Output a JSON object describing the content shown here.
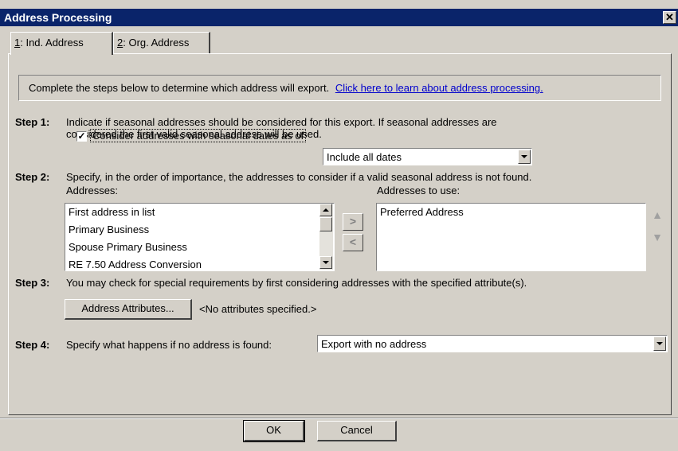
{
  "window": {
    "title": "Address Processing",
    "close_symbol": "✕"
  },
  "tabs": [
    {
      "hotkey": "1",
      "rest": ": Ind. Address"
    },
    {
      "hotkey": "2",
      "rest": ": Org. Address"
    }
  ],
  "intro": {
    "text": "Complete the steps below to determine which address will export.",
    "link": "Click here to learn about address processing."
  },
  "step1": {
    "label": "Step 1:",
    "line1": "Indicate if seasonal addresses should be considered for this export.  If seasonal addresses are",
    "line2": "considered the first valid seasonal address will be used.",
    "checkbox_checked": true,
    "checkbox_mark": "✓",
    "checkbox_label": "Consider addresses with seasonal dates as of",
    "dates_select_value": "Include all dates"
  },
  "step2": {
    "label": "Step 2:",
    "text": "Specify, in the order of importance, the addresses to consider if a valid seasonal address is not found.",
    "addresses_label": "Addresses:",
    "addresses": [
      "First address in list",
      "Primary Business",
      "Spouse Primary Business",
      "RE 7.50 Address Conversion"
    ],
    "addresses_to_use_label": "Addresses to use:",
    "addresses_to_use": [
      "Preferred Address"
    ],
    "add_symbol": ">",
    "remove_symbol": "<",
    "move_up_symbol": "▲",
    "move_down_symbol": "▼"
  },
  "step3": {
    "label": "Step 3:",
    "text": "You may check for special requirements by first considering addresses with the specified attribute(s).",
    "button_label": "Address Attributes...",
    "status": "<No attributes specified.>"
  },
  "step4": {
    "label": "Step 4:",
    "text": "Specify what happens if no address is found:",
    "select_value": "Export with no address"
  },
  "footer": {
    "ok_label": "OK",
    "cancel_label": "Cancel"
  }
}
